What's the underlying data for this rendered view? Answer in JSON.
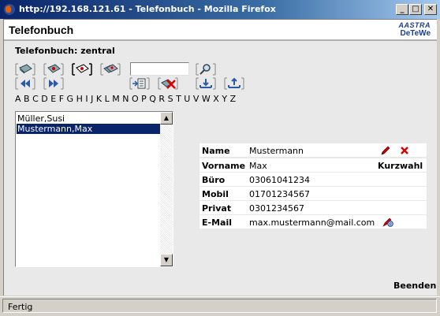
{
  "window": {
    "title": "http://192.168.121.61 - Telefonbuch - Mozilla Firefox",
    "minimize_label": "_",
    "maximize_label": "□",
    "close_label": "✕"
  },
  "header": {
    "title": "Telefonbuch",
    "logo_line1": "AASTRA",
    "logo_line2": "DeTeWe",
    "brand_color": "#1d3f8a"
  },
  "phonebook_label": "Telefonbuch: zentral",
  "toolbar": {
    "row1": [
      "phonebook-icon",
      "phonebook-red-icon",
      "phonebook-active-icon",
      "phonebook-multi-icon"
    ],
    "search_value": "",
    "row2": [
      "first-page-icon",
      "next-page-icon",
      "import-icon",
      "delete-all-icon",
      "upload-down-icon",
      "upload-up-icon"
    ]
  },
  "alphabet": [
    "A",
    "B",
    "C",
    "D",
    "E",
    "F",
    "G",
    "H",
    "I",
    "J",
    "K",
    "L",
    "M",
    "N",
    "O",
    "P",
    "Q",
    "R",
    "S",
    "T",
    "U",
    "V",
    "W",
    "X",
    "Y",
    "Z"
  ],
  "contacts": [
    {
      "name": "Müller,Susi",
      "selected": false
    },
    {
      "name": "Mustermann,Max",
      "selected": true
    }
  ],
  "detail": {
    "name_label": "Name",
    "name_value": "Mustermann",
    "vorname_label": "Vorname",
    "vorname_value": "Max",
    "kurzwahl_label": "Kurzwahl",
    "buero_label": "Büro",
    "buero_value": "03061041234",
    "mobil_label": "Mobil",
    "mobil_value": "01701234567",
    "privat_label": "Privat",
    "privat_value": "0301234567",
    "email_label": "E-Mail",
    "email_value": "max.mustermann@mail.com"
  },
  "beenden_label": "Beenden",
  "status": "Fertig"
}
